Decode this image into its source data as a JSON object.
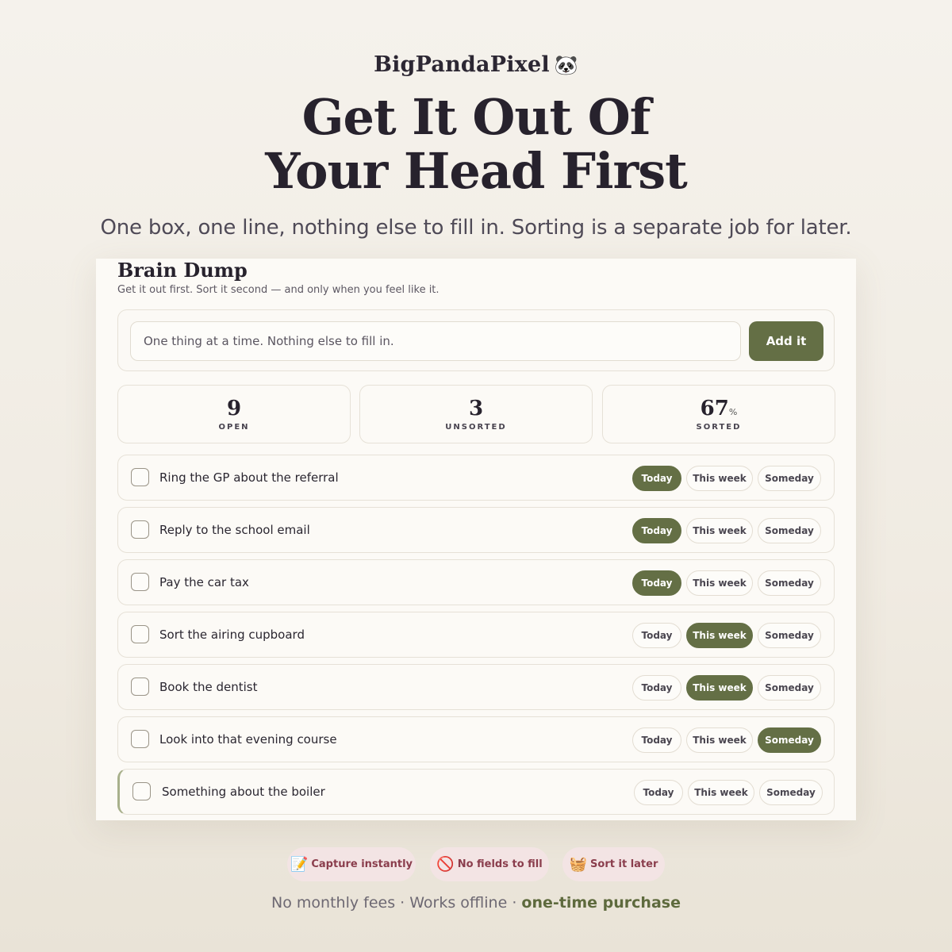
{
  "brand": {
    "name": "BigPandaPixel",
    "emoji": "🐼"
  },
  "hero": {
    "headline_line1": "Get It Out Of",
    "headline_line2": "Your Head First",
    "subhead": "One box, one line, nothing else to fill in. Sorting is a separate job for later."
  },
  "panel": {
    "title": "Brain Dump",
    "subtitle": "Get it out first. Sort it second — and only when you feel like it.",
    "capture": {
      "placeholder": "One thing at a time. Nothing else to fill in.",
      "value": "",
      "button_label": "Add it"
    },
    "stats": [
      {
        "value": "9",
        "label": "OPEN"
      },
      {
        "value": "3",
        "label": "UNSORTED"
      },
      {
        "value": "67",
        "suffix": "%",
        "label": "SORTED"
      }
    ],
    "sort_labels": {
      "today": "Today",
      "week": "This week",
      "someday": "Someday"
    },
    "items": [
      {
        "text": "Ring the GP about the referral",
        "selected": "today",
        "done": false
      },
      {
        "text": "Reply to the school email",
        "selected": "today",
        "done": false
      },
      {
        "text": "Pay the car tax",
        "selected": "today",
        "done": false
      },
      {
        "text": "Sort the airing cupboard",
        "selected": "week",
        "done": false
      },
      {
        "text": "Book the dentist",
        "selected": "week",
        "done": false
      },
      {
        "text": "Look into that evening course",
        "selected": "someday",
        "done": false
      },
      {
        "text": "Something about the boiler",
        "selected": "",
        "done": false
      }
    ]
  },
  "features": [
    {
      "icon": "memo-pencil-icon",
      "glyph": "📝",
      "label": "Capture instantly"
    },
    {
      "icon": "prohibited-icon",
      "glyph": "🚫",
      "label": "No fields to fill"
    },
    {
      "icon": "basket-icon",
      "glyph": "🧺",
      "label": "Sort it later"
    }
  ],
  "footer": {
    "text": "No monthly fees · Works offline · ",
    "accent": "one-time purchase"
  },
  "colors": {
    "accent_green": "#646f45",
    "feature_pill_bg": "#f3e4e4",
    "feature_pill_text": "#8a3d4c",
    "background": "#f3efe8"
  }
}
